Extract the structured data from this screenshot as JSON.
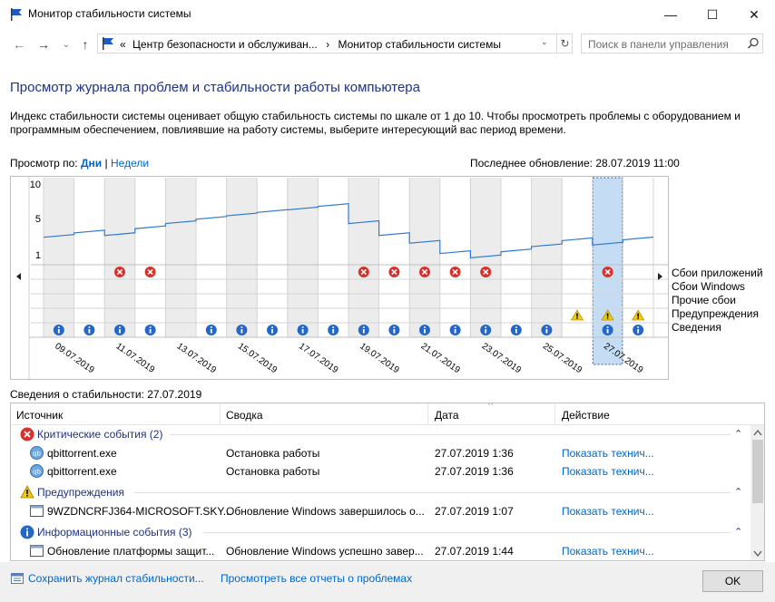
{
  "window": {
    "title": "Монитор стабильности системы",
    "minimize_glyph": "—",
    "maximize_glyph": "☐",
    "close_glyph": "✕"
  },
  "nav": {
    "back_glyph": "←",
    "forward_glyph": "→",
    "history_glyph": "⌄",
    "up_glyph": "↑",
    "breadcrumb_prefix": "«",
    "breadcrumb_1": "Центр безопасности и обслуживан...",
    "breadcrumb_sep": "›",
    "breadcrumb_2": "Монитор стабильности системы",
    "dropdown_glyph": "⌄",
    "refresh_glyph": "↻",
    "search_placeholder": "Поиск в панели управления"
  },
  "page": {
    "heading": "Просмотр журнала проблем и стабильности работы компьютера",
    "description": "Индекс стабильности системы оценивает общую стабильность системы по шкале от 1 до 10. Чтобы просмотреть проблемы с оборудованием и программным обеспечением, повлиявшие на работу системы, выберите интересующий вас период времени.",
    "view_by_label": "Просмотр по:",
    "view_days": "Дни",
    "view_sep": "|",
    "view_weeks": "Недели",
    "last_updated": "Последнее обновление: 28.07.2019 11:00"
  },
  "chart_data": {
    "type": "line",
    "y_ticks": [
      "10",
      "5",
      "1"
    ],
    "dates": [
      "09.07.2019",
      "11.07.2019",
      "13.07.2019",
      "15.07.2019",
      "17.07.2019",
      "19.07.2019",
      "21.07.2019",
      "23.07.2019",
      "25.07.2019",
      "27.07.2019"
    ],
    "num_columns": 20,
    "selected_column": 18,
    "stability_index": [
      4.0,
      4.5,
      4.2,
      5.0,
      5.6,
      6.1,
      6.5,
      6.9,
      7.2,
      7.6,
      5.6,
      4.2,
      3.3,
      2.1,
      1.6,
      2.3,
      2.9,
      3.6,
      3.1,
      3.7
    ],
    "rows": [
      "Сбои приложений",
      "Сбои Windows",
      "Прочие сбои",
      "Предупреждения",
      "Сведения"
    ],
    "app_failures": [
      2,
      3,
      10,
      11,
      12,
      13,
      14,
      18
    ],
    "warnings": [
      17,
      18,
      19
    ],
    "info": [
      0,
      1,
      2,
      3,
      5,
      6,
      7,
      8,
      9,
      10,
      11,
      12,
      13,
      14,
      15,
      16,
      18,
      19
    ],
    "colors": {
      "line": "#2f7bd4",
      "selected": "#c4ddf5",
      "shade": "#ececec",
      "error": "#d9302c",
      "warning": "#f2c811",
      "info": "#2467c7"
    }
  },
  "details": {
    "label": "Сведения о стабильности: 27.07.2019",
    "columns": [
      "Источник",
      "Сводка",
      "Дата",
      "Действие"
    ],
    "groups": [
      {
        "title": "Критические события (2)",
        "icon": "error-icon",
        "rows": [
          {
            "source": "qbittorrent.exe",
            "summary": "Остановка работы",
            "date": "27.07.2019 1:36",
            "action": "Показать технич..."
          },
          {
            "source": "qbittorrent.exe",
            "summary": "Остановка работы",
            "date": "27.07.2019 1:36",
            "action": "Показать технич..."
          }
        ]
      },
      {
        "title": "Предупреждения",
        "icon": "warning-icon",
        "rows": [
          {
            "source": "9WZDNCRFJ364-MICROSOFT.SKY...",
            "summary": "Обновление Windows завершилось о...",
            "date": "27.07.2019 1:07",
            "action": "Показать технич..."
          }
        ]
      },
      {
        "title": "Информационные события (3)",
        "icon": "info-icon",
        "rows": [
          {
            "source": "Обновление платформы защит...",
            "summary": "Обновление Windows успешно завер...",
            "date": "27.07.2019 1:44",
            "action": "Показать технич..."
          }
        ]
      }
    ],
    "collapse_glyph": "⌃",
    "sort_glyph": "^"
  },
  "footer": {
    "save_link": "Сохранить журнал стабильности...",
    "view_link": "Просмотреть все отчеты о проблемах",
    "ok_label": "OK"
  }
}
